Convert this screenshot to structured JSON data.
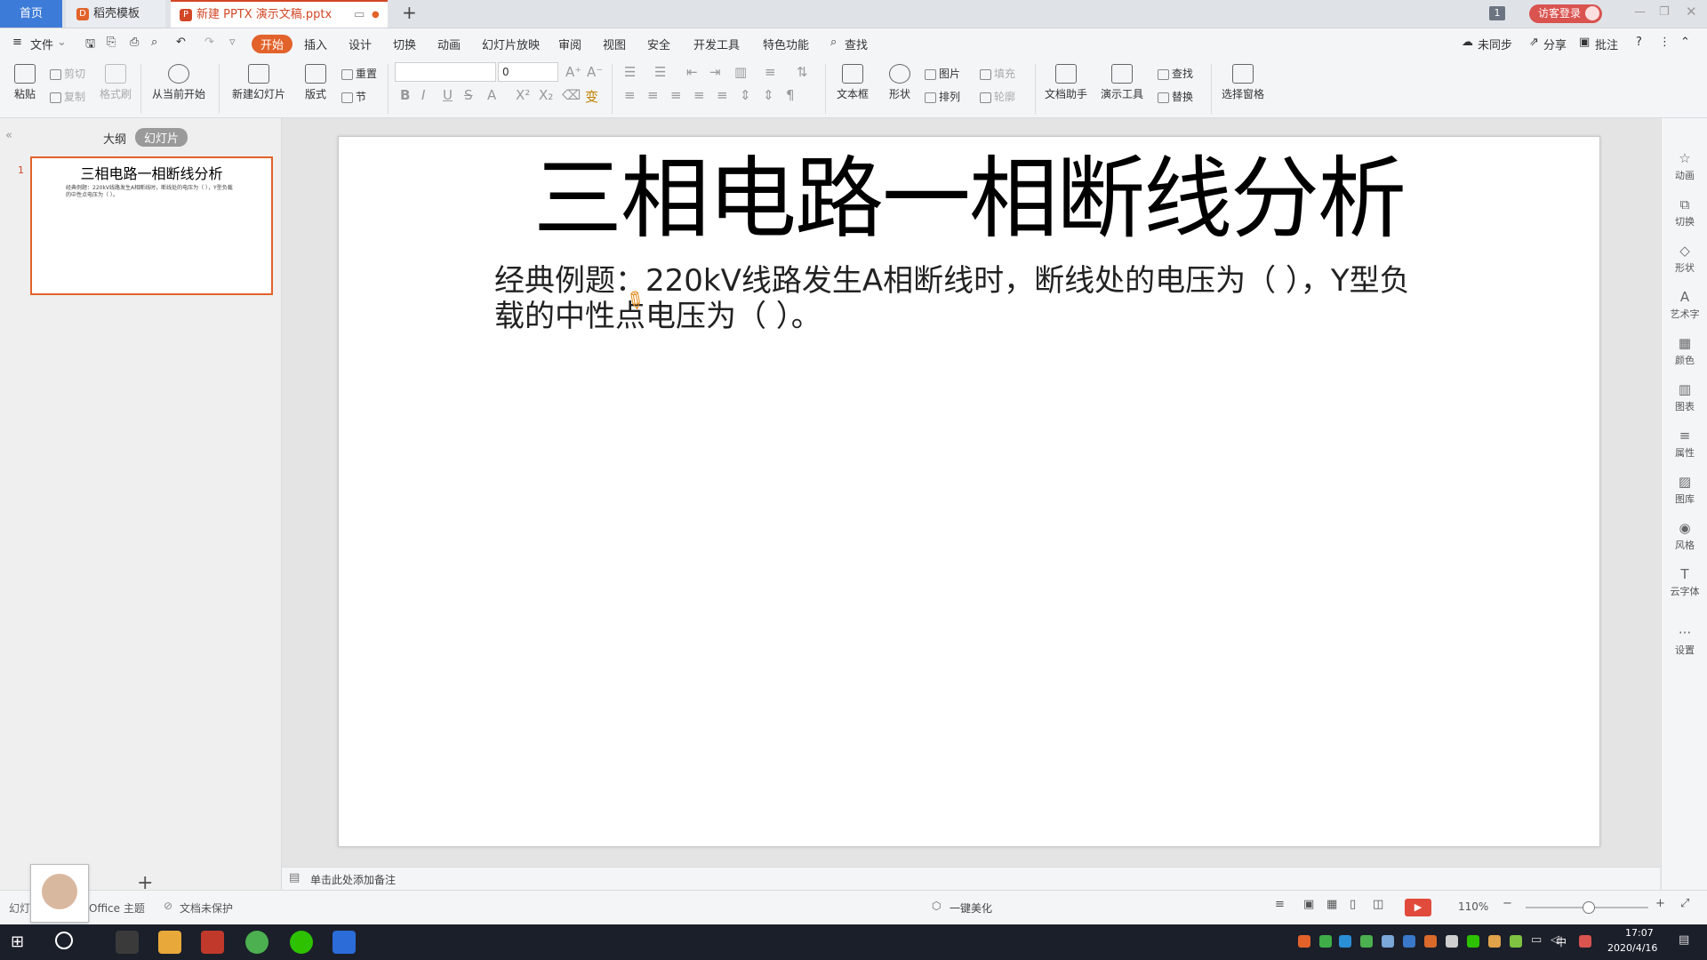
{
  "tabs": {
    "home": "首页",
    "template": "稻壳模板",
    "doc": "新建 PPTX 演示文稿.pptx",
    "badge": "1",
    "login": "访客登录"
  },
  "menu": {
    "file": "文件",
    "items": [
      "开始",
      "插入",
      "设计",
      "切换",
      "动画",
      "幻灯片放映",
      "审阅",
      "视图",
      "安全",
      "开发工具",
      "特色功能"
    ],
    "search": "查找",
    "sync": "未同步",
    "share": "分享",
    "comment": "批注"
  },
  "ribbon": {
    "paste": "粘贴",
    "cut": "剪切",
    "copy": "复制",
    "format_painter": "格式刷",
    "from_current": "从当前开始",
    "new_slide": "新建幻灯片",
    "layout": "版式",
    "reset": "重置",
    "section": "节",
    "font_name": "",
    "font_size": "0",
    "textbox": "文本框",
    "shape": "形状",
    "picture": "图片",
    "fill": "填充",
    "arrange": "排列",
    "outline": "轮廓",
    "doc_assistant": "文档助手",
    "present_tools": "演示工具",
    "find": "查找",
    "replace": "替换",
    "select_pane": "选择窗格"
  },
  "panel": {
    "outline_tab": "大纲",
    "slides_tab": "幻灯片",
    "slide_number": "1",
    "thumb_title": "三相电路一相断线分析",
    "thumb_body": "经典例题：220kV线路发生A相断线时，断线处的电压为（ ），Y型负载的中性点电压为（ ）。"
  },
  "slide": {
    "title": "三相电路一相断线分析",
    "body": "经典例题：220kV线路发生A相断线时，断线处的电压为（ ），Y型负载的中性点电压为（ ）。"
  },
  "right_tools": [
    "动画",
    "切换",
    "形状",
    "艺术字",
    "颜色",
    "图表",
    "属性",
    "图库",
    "风格",
    "云字体",
    "设置"
  ],
  "notes": "单击此处添加备注",
  "status": {
    "slide_label": "幻灯",
    "theme": "Office 主题",
    "protect": "文档未保护",
    "beautify": "一键美化",
    "zoom": "110%"
  },
  "taskbar": {
    "time": "17:07",
    "date": "2020/4/16",
    "ime": "中"
  }
}
